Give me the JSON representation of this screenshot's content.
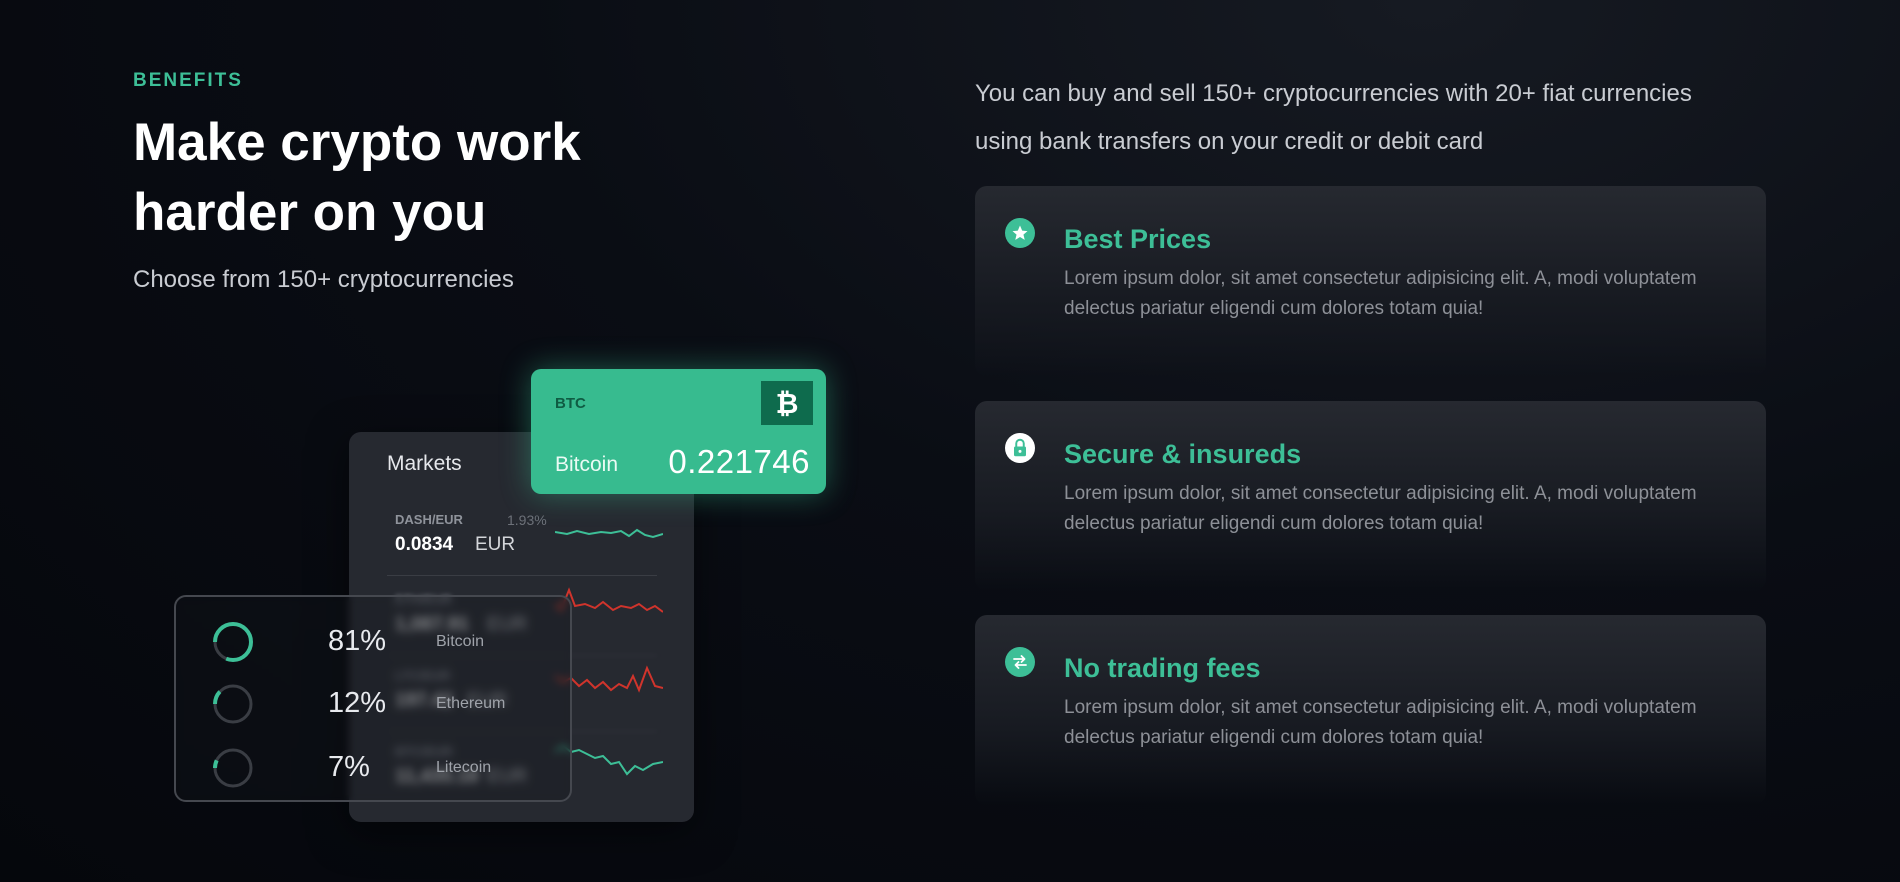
{
  "header": {
    "eyebrow": "BENEFITS",
    "title": "Make crypto work harder on you",
    "subtitle": "Choose from 150+ cryptocurrencies"
  },
  "intro": "You can buy and sell 150+ cryptocurrencies with 20+ fiat currencies using bank transfers on your credit or debit card",
  "illustration": {
    "markets": {
      "title": "Markets",
      "rows": [
        {
          "pair": "DASH/EUR",
          "change": "1.93%",
          "price": "0.0834",
          "currency": "EUR",
          "trend": "green"
        },
        {
          "pair": "ETH/EUR",
          "change": "",
          "price": "1,087.91",
          "currency": "EUR",
          "trend": "red"
        },
        {
          "pair": "LTC/EUR",
          "change": "",
          "price": "197.42",
          "currency": "EUR",
          "trend": "red"
        },
        {
          "pair": "BTC/EUR",
          "change": "",
          "price": "11,435.18",
          "currency": "EUR",
          "trend": "green"
        }
      ]
    },
    "btc_card": {
      "symbol": "BTC",
      "name": "Bitcoin",
      "value": "0.221746",
      "icon": "bitcoin-icon"
    },
    "allocation": [
      {
        "percent": "81%",
        "coin": "Bitcoin",
        "fraction": 0.81
      },
      {
        "percent": "12%",
        "coin": "Ethereum",
        "fraction": 0.12
      },
      {
        "percent": "7%",
        "coin": "Litecoin",
        "fraction": 0.07
      }
    ]
  },
  "features": [
    {
      "icon": "star-icon",
      "title": "Best Prices",
      "description": "Lorem ipsum dolor, sit amet consectetur adipisicing elit. A, modi voluptatem delectus pariatur eligendi cum dolores totam quia!"
    },
    {
      "icon": "lock-icon",
      "title": "Secure & insureds",
      "description": "Lorem ipsum dolor, sit amet consectetur adipisicing elit. A, modi voluptatem delectus pariatur eligendi cum dolores totam quia!"
    },
    {
      "icon": "swap-arrows-icon",
      "title": "No trading fees",
      "description": "Lorem ipsum dolor, sit amet consectetur adipisicing elit. A, modi voluptatem delectus pariatur eligendi cum dolores totam quia!"
    }
  ],
  "colors": {
    "accent": "#3dbf97",
    "background": "#05070c",
    "card": "#262930",
    "down": "#d0342c"
  }
}
